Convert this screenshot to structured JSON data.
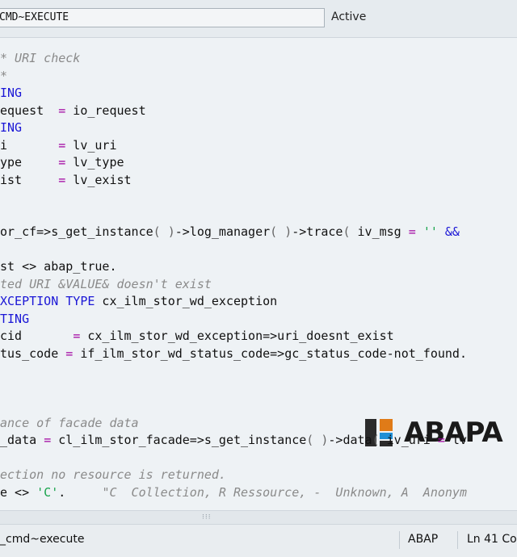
{
  "header": {
    "method_name": "CMD~EXECUTE",
    "status": "Active"
  },
  "code": {
    "lines": [
      {
        "segments": [
          {
            "t": "cm",
            "v": "* URI check"
          }
        ]
      },
      {
        "segments": [
          {
            "t": "cm",
            "v": "*"
          }
        ]
      },
      {
        "segments": [
          {
            "t": "kw",
            "v": "ING"
          }
        ]
      },
      {
        "segments": [
          {
            "t": "tx",
            "v": "equest  "
          },
          {
            "t": "op",
            "v": "="
          },
          {
            "t": "tx",
            "v": " io_request"
          }
        ]
      },
      {
        "segments": [
          {
            "t": "kw",
            "v": "ING"
          }
        ]
      },
      {
        "segments": [
          {
            "t": "tx",
            "v": "i       "
          },
          {
            "t": "op",
            "v": "="
          },
          {
            "t": "tx",
            "v": " lv_uri"
          }
        ]
      },
      {
        "segments": [
          {
            "t": "tx",
            "v": "ype     "
          },
          {
            "t": "op",
            "v": "="
          },
          {
            "t": "tx",
            "v": " lv_type"
          }
        ]
      },
      {
        "segments": [
          {
            "t": "tx",
            "v": "ist     "
          },
          {
            "t": "op",
            "v": "="
          },
          {
            "t": "tx",
            "v": " lv_exist"
          }
        ]
      },
      {
        "segments": []
      },
      {
        "segments": []
      },
      {
        "segments": [
          {
            "t": "tx",
            "v": "or_cf=>s_get_instance"
          },
          {
            "t": "pu",
            "v": "( )"
          },
          {
            "t": "tx",
            "v": "->log_manager"
          },
          {
            "t": "pu",
            "v": "( )"
          },
          {
            "t": "tx",
            "v": "->trace"
          },
          {
            "t": "pu",
            "v": "("
          },
          {
            "t": "tx",
            "v": " iv_msg "
          },
          {
            "t": "op",
            "v": "="
          },
          {
            "t": "tx",
            "v": " "
          },
          {
            "t": "st",
            "v": "''"
          },
          {
            "t": "tx",
            "v": " "
          },
          {
            "t": "kw",
            "v": "&&"
          }
        ]
      },
      {
        "segments": []
      },
      {
        "segments": [
          {
            "t": "tx",
            "v": "st <> abap_true."
          }
        ]
      },
      {
        "segments": [
          {
            "t": "cm",
            "v": "ted URI &VALUE& doesn't exist"
          }
        ]
      },
      {
        "segments": [
          {
            "t": "kw",
            "v": "XCEPTION TYPE"
          },
          {
            "t": "tx",
            "v": " cx_ilm_stor_wd_exception"
          }
        ]
      },
      {
        "segments": [
          {
            "t": "kw",
            "v": "TING"
          }
        ]
      },
      {
        "segments": [
          {
            "t": "tx",
            "v": "cid       "
          },
          {
            "t": "op",
            "v": "="
          },
          {
            "t": "tx",
            "v": " cx_ilm_stor_wd_exception=>uri_doesnt_exist"
          }
        ]
      },
      {
        "segments": [
          {
            "t": "tx",
            "v": "tus_code "
          },
          {
            "t": "op",
            "v": "="
          },
          {
            "t": "tx",
            "v": " if_ilm_stor_wd_status_code=>gc_status_code-not_found."
          }
        ]
      },
      {
        "segments": []
      },
      {
        "segments": []
      },
      {
        "segments": []
      },
      {
        "segments": [
          {
            "t": "cm",
            "v": "ance of facade data"
          }
        ]
      },
      {
        "segments": [
          {
            "t": "tx",
            "v": "_data "
          },
          {
            "t": "op",
            "v": "="
          },
          {
            "t": "tx",
            "v": " cl_ilm_stor_facade=>s_get_instance"
          },
          {
            "t": "pu",
            "v": "( )"
          },
          {
            "t": "tx",
            "v": "->data"
          },
          {
            "t": "pu",
            "v": "("
          },
          {
            "t": "tx",
            "v": " iv_uri "
          },
          {
            "t": "op",
            "v": "="
          },
          {
            "t": "tx",
            "v": " lv"
          }
        ]
      },
      {
        "segments": []
      },
      {
        "segments": [
          {
            "t": "cm",
            "v": "ection no resource is returned."
          }
        ]
      },
      {
        "segments": [
          {
            "t": "tx",
            "v": "e <> "
          },
          {
            "t": "st",
            "v": "'C'"
          },
          {
            "t": "tx",
            "v": ".     "
          },
          {
            "t": "cm",
            "v": "\"C  Collection, R Ressource, -  Unknown, A  Anonym"
          }
        ]
      }
    ]
  },
  "logo": {
    "text": "ABAPA",
    "colors": [
      "#2b2b2b",
      "#e07b18",
      "#1f8fd6",
      "#2b2b2b"
    ]
  },
  "status_bar": {
    "method": "_cmd~execute",
    "language": "ABAP",
    "position": "Ln  41 Co"
  },
  "colors": {
    "keyword": "#1b17d6",
    "comment": "#8a8a8a",
    "operator": "#a000a0",
    "string": "#16a34a",
    "background": "#eef2f5"
  }
}
